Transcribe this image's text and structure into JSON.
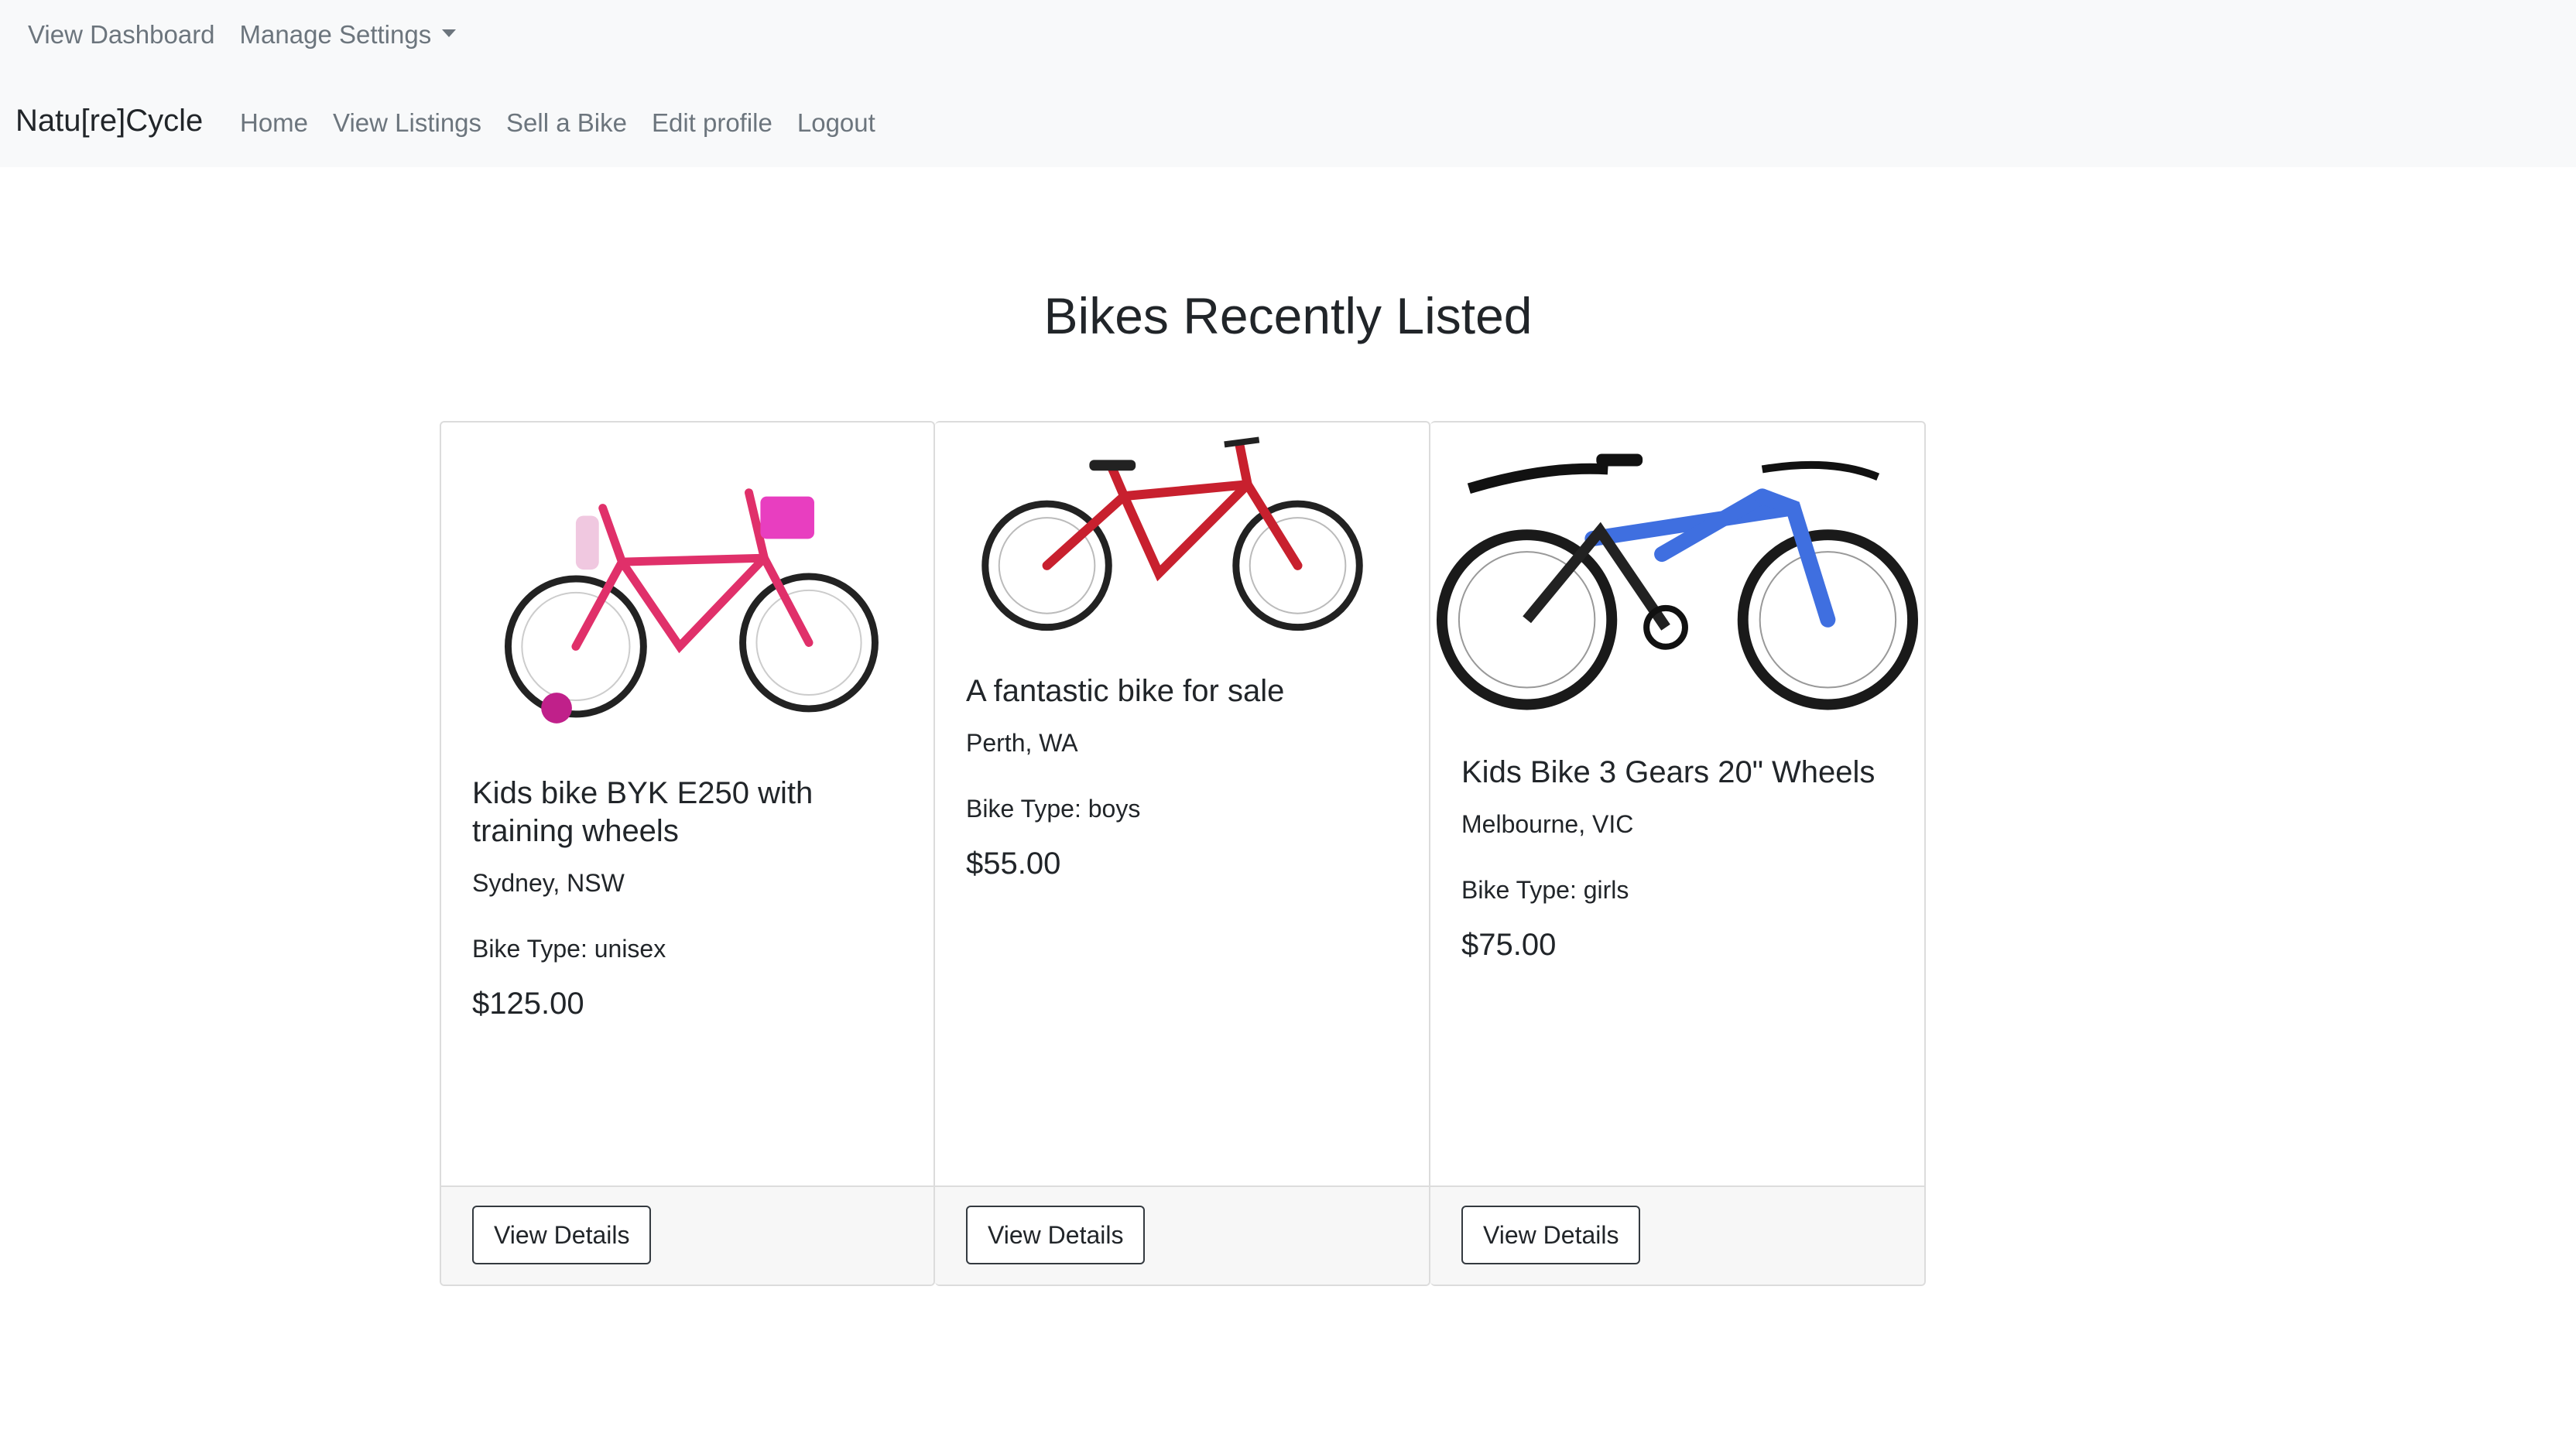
{
  "nav": {
    "top_links": [
      "View Dashboard",
      "Manage Settings"
    ],
    "brand": "Natu[re]Cycle",
    "links": [
      "Home",
      "View Listings",
      "Sell a Bike",
      "Edit profile",
      "Logout"
    ]
  },
  "main": {
    "title": "Bikes Recently Listed",
    "listings": [
      {
        "title": "Kids bike BYK E250 with training wheels",
        "location": "Sydney, NSW",
        "bike_type": "Bike Type: unisex",
        "price": "$125.00",
        "button": "View Details",
        "frame_color": "#e0306a"
      },
      {
        "title": "A fantastic bike for sale",
        "location": "Perth, WA",
        "bike_type": "Bike Type: boys",
        "price": "$55.00",
        "button": "View Details",
        "frame_color": "#c8202e"
      },
      {
        "title": "Kids Bike 3 Gears 20\" Wheels",
        "location": "Melbourne, VIC",
        "bike_type": "Bike Type: girls",
        "price": "$75.00",
        "button": "View Details",
        "frame_color": "#3f6fe0"
      }
    ]
  }
}
